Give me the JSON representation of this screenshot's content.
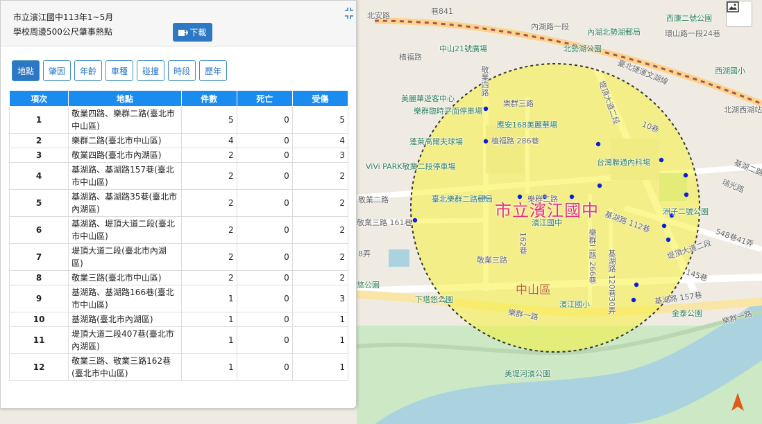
{
  "panel": {
    "title_line1": "市立濱江國中113年1~5月",
    "title_line2": "學校周邊500公尺肇事熱點",
    "download_label": "下載",
    "tabs": [
      {
        "label": "地點",
        "active": true
      },
      {
        "label": "肇因",
        "active": false
      },
      {
        "label": "年齡",
        "active": false
      },
      {
        "label": "車種",
        "active": false
      },
      {
        "label": "碰撞",
        "active": false
      },
      {
        "label": "時段",
        "active": false
      },
      {
        "label": "歷年",
        "active": false
      }
    ],
    "table": {
      "headers": [
        "項次",
        "地點",
        "件數",
        "死亡",
        "受傷"
      ],
      "rows": [
        {
          "idx": "1",
          "place": "敬業四路、樂群二路(臺北市中山區)",
          "count": "5",
          "deaths": "0",
          "injuries": "5"
        },
        {
          "idx": "2",
          "place": "樂群二路(臺北市中山區)",
          "count": "4",
          "deaths": "0",
          "injuries": "4"
        },
        {
          "idx": "3",
          "place": "敬業四路(臺北市內湖區)",
          "count": "2",
          "deaths": "0",
          "injuries": "3"
        },
        {
          "idx": "4",
          "place": "基湖路、基湖路157巷(臺北市中山區)",
          "count": "2",
          "deaths": "0",
          "injuries": "2"
        },
        {
          "idx": "5",
          "place": "基湖路、基湖路35巷(臺北市內湖區)",
          "count": "2",
          "deaths": "0",
          "injuries": "2"
        },
        {
          "idx": "6",
          "place": "基湖路、堤頂大道二段(臺北市中山區)",
          "count": "2",
          "deaths": "0",
          "injuries": "2"
        },
        {
          "idx": "7",
          "place": "堤頂大道二段(臺北市內湖區)",
          "count": "2",
          "deaths": "0",
          "injuries": "2"
        },
        {
          "idx": "8",
          "place": "敬業三路(臺北市中山區)",
          "count": "2",
          "deaths": "0",
          "injuries": "2"
        },
        {
          "idx": "9",
          "place": "基湖路、基湖路166巷(臺北市中山區)",
          "count": "1",
          "deaths": "0",
          "injuries": "3"
        },
        {
          "idx": "10",
          "place": "基湖路(臺北市內湖區)",
          "count": "1",
          "deaths": "0",
          "injuries": "1"
        },
        {
          "idx": "11",
          "place": "堤頂大道二段407巷(臺北市內湖區)",
          "count": "1",
          "deaths": "0",
          "injuries": "1"
        },
        {
          "idx": "12",
          "place": "敬業三路、敬業三路162巷(臺北市中山區)",
          "count": "1",
          "deaths": "0",
          "injuries": "1"
        }
      ]
    }
  },
  "map": {
    "school_label": "市立濱江國中",
    "district_label": "中山區",
    "labels": {
      "north_anxi_road": "北安路",
      "lane_841": "巷841",
      "neihu_road_sec1": "內湖路一段",
      "neihu_beishi_lake": "內湖北勢湖郵局",
      "chuanshan_road": "環山路一段24巷",
      "xihu_park": "西康二號公園",
      "chuanfu_road": "植福路",
      "zhongshan_21": "中山21號廣場",
      "beishihu_park": "北勢湖公園",
      "mrt_wenhu": "臺北捷運文湖線",
      "xihu_elem": "西湖國小",
      "lane_285": "285巷",
      "jingye_4th_rd": "敬業四路",
      "meilihua": "美麗華遊客中心",
      "leqin_3rd_rd": "樂群三路",
      "leqin_temp_parking": "樂群臨時平面停車場",
      "yingan_168": "應安168美麗華場",
      "tidingdadao": "堤頂大道二段",
      "jihu_road_2": "基湖路",
      "lane_10": "10巷",
      "beihu_west_lake": "北湖西湖站",
      "penglai": "蓬萊高爾夫球場",
      "chuanfu_286": "植福路 286巷",
      "tw_neihu": "台灣聯通內科場",
      "jihu_2nd_road": "基湖二路",
      "vivi_park": "ViVi PARK敬業二段停車場",
      "ruiguang_road": "瑞光路",
      "leqin_2nd_rd": "臺北樂群二路郵局",
      "leqin_2nd_rd_b": "樂群二路",
      "jingye_2nd_rd": "敬業二路",
      "no_2_park": "洲子二號公園",
      "jihu_112": "基湖路 112巷",
      "jingye_3rd_161": "敬業三路 161巷",
      "binjiang_middle": "濱江國中",
      "lane_162": "162巷",
      "lane_548": "548巷41弄",
      "lane_8": "8弄",
      "jingye_3rd_rd": "敬業三路",
      "jihu_266": "樂群二路 266巷",
      "jihu_120_30": "基湖路 120巷30弄",
      "tidingdadao_2": "堤頂大道二段",
      "lane_145": "145巷",
      "youyou_park": "悠公園",
      "xiatayou_park": "下塔悠公園",
      "binjiang_elem": "濱江國小",
      "jihu_157": "基湖路 157巷",
      "jinquan_park": "金泰公園",
      "leqin_1st_rd": "樂群一路",
      "jingye_1st_rd": "樂群一路",
      "meiti_park": "美堤河濱公園"
    },
    "accent": "#f2ee4a",
    "accident_color": "#0a1ee0"
  }
}
